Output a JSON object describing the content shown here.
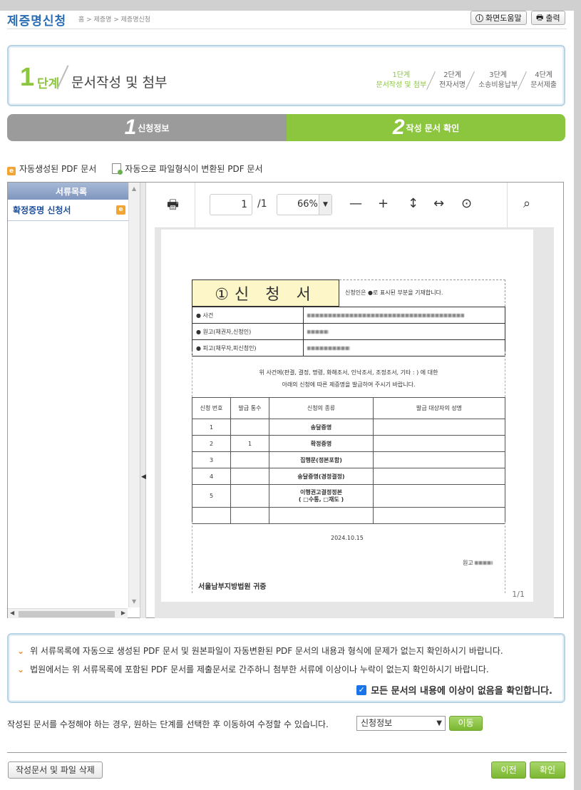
{
  "header": {
    "title": "제증명신청",
    "breadcrumb": "홈 > 제증명 > 제증명신청",
    "help_label": "화면도움말",
    "print_label": "출력"
  },
  "stepbox": {
    "num": "1",
    "dan": "단계",
    "name": "문서작성 및 첨부",
    "steps": [
      {
        "top": "1단계",
        "bottom": "문서작성 및 첨부"
      },
      {
        "top": "2단계",
        "bottom": "전자서명"
      },
      {
        "top": "3단계",
        "bottom": "소송비용납부"
      },
      {
        "top": "4단계",
        "bottom": "문서제출"
      }
    ]
  },
  "tabs": [
    {
      "num": "1",
      "label": "신청정보"
    },
    {
      "num": "2",
      "label": "작성 문서 확인"
    }
  ],
  "legend": {
    "auto_pdf": "자동생성된 PDF 문서",
    "converted_pdf": "자동으로 파일형식이 변환된 PDF 문서"
  },
  "doclist": {
    "header": "서류목록",
    "items": [
      {
        "label": "확정증명 신청서"
      }
    ]
  },
  "pdf_toolbar": {
    "page": "1",
    "page_of": "/1",
    "zoom": "66%"
  },
  "form": {
    "title": "①신 청 서",
    "note": "신청인은 ●로 표시된 부분을 기재합니다.",
    "rows": [
      "● 사건",
      "● 원고(채권자,신청인)",
      "● 피고(채무자,피신청인)"
    ],
    "para1": "위 사건에(판결, 결정, 명령, 화해조서, 인낙조서, 조정조서, 기타 :                        ) 에 대한",
    "para2": "아래의 신청에 따른 제증명을 발급하여 주시기 바랍니다.",
    "col_headers": [
      "신청 번호",
      "발급 통수",
      "신청의 종류",
      "발급 대상자의 성명"
    ],
    "req_rows": [
      {
        "no": "1",
        "count": "",
        "kind": "송달증명"
      },
      {
        "no": "2",
        "count": "1",
        "kind": "확정증명"
      },
      {
        "no": "3",
        "count": "",
        "kind": "집행문(정본포함)"
      },
      {
        "no": "4",
        "count": "",
        "kind": "송달증명(경정결정)"
      },
      {
        "no": "5",
        "count": "",
        "kind": "이행권고결정정본\n( □수통, □재도 )"
      }
    ],
    "date": "2024.10.15",
    "plaintiff": "원고",
    "court": "서울남부지방법원  귀중",
    "page_label": "1/1"
  },
  "notice": {
    "line1": "위 서류목록에 자동으로 생성된 PDF 문서 및 원본파일이 자동변환된 PDF 문서의 내용과 형식에 문제가 없는지 확인하시기 바랍니다.",
    "line2": "법원에서는 위 서류목록에 포함된 PDF 문서를 제출문서로 간주하니 첨부한 서류에 이상이나 누락이 없는지 확인하시기 바랍니다.",
    "confirm": "모든 문서의 내용에 이상이 없음을 확인합니다."
  },
  "edit": {
    "text": "작성된 문서를 수정해야 하는 경우, 원하는 단계를 선택한 후 이동하여 수정할 수 있습니다.",
    "select_value": "신청정보",
    "move_label": "이동"
  },
  "footer": {
    "delete_label": "작성문서 및 파일 삭제",
    "prev_label": "이전",
    "ok_label": "확인"
  }
}
